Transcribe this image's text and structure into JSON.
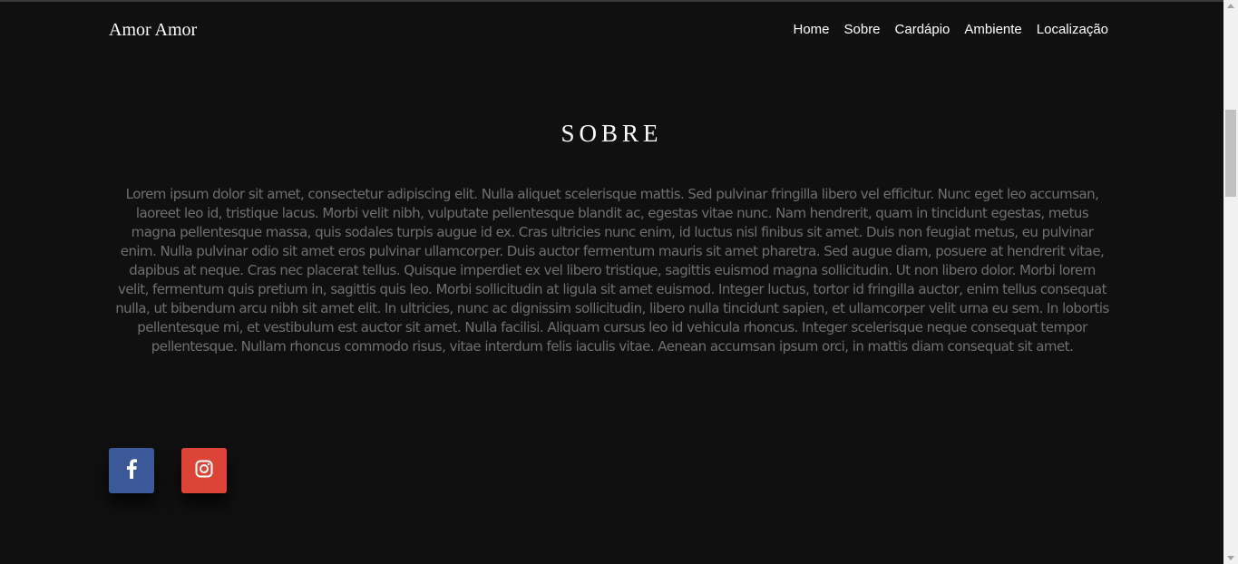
{
  "header": {
    "brand": "Amor Amor",
    "nav": [
      "Home",
      "Sobre",
      "Cardápio",
      "Ambiente",
      "Localização"
    ]
  },
  "about": {
    "title": "SOBRE",
    "text": "Lorem ipsum dolor sit amet, consectetur adipiscing elit. Nulla aliquet scelerisque mattis. Sed pulvinar fringilla libero vel efficitur. Nunc eget leo accumsan, laoreet leo id, tristique lacus. Morbi velit nibh, vulputate pellentesque blandit ac, egestas vitae nunc. Nam hendrerit, quam in tincidunt egestas, metus magna pellentesque massa, quis sodales turpis augue id ex. Cras ultricies nunc enim, id luctus nisl finibus sit amet. Duis non feugiat metus, eu pulvinar enim. Nulla pulvinar odio sit amet eros pulvinar ullamcorper. Duis auctor fermentum mauris sit amet pharetra. Sed augue diam, posuere at hendrerit vitae, dapibus at neque. Cras nec placerat tellus. Quisque imperdiet ex vel libero tristique, sagittis euismod magna sollicitudin. Ut non libero dolor. Morbi lorem velit, fermentum quis pretium in, sagittis quis leo. Morbi sollicitudin at ligula sit amet euismod. Integer luctus, tortor id fringilla auctor, enim tellus consequat nulla, ut bibendum arcu nibh sit amet elit. In ultricies, nunc ac dignissim sollicitudin, libero nulla tincidunt sapien, et ullamcorper velit urna eu sem. In lobortis pellentesque mi, et vestibulum est auctor sit amet. Nulla facilisi. Aliquam cursus leo id vehicula rhoncus. Integer scelerisque neque consequat tempor pellentesque. Nullam rhoncus commodo risus, vitae interdum felis iaculis vitae. Aenean accumsan ipsum orci, in mattis diam consequat sit amet."
  },
  "social": [
    {
      "icon": "facebook-icon",
      "color": "#3b5998"
    },
    {
      "icon": "instagram-icon",
      "color": "#db4437"
    }
  ],
  "colors": {
    "background": "#101010",
    "text_muted": "#6f6f6f",
    "heading": "#ffffff"
  }
}
